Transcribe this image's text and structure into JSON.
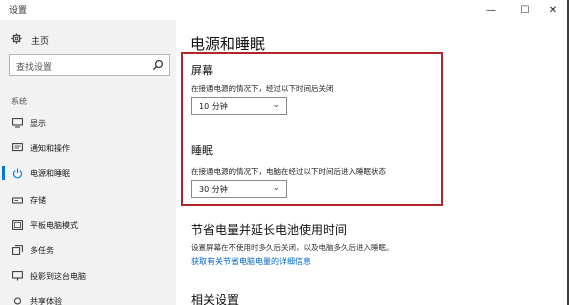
{
  "window": {
    "title": "设置",
    "minimize_glyph": "—",
    "maximize_glyph": "☐",
    "close_glyph": "✕"
  },
  "sidebar": {
    "home_label": "主页",
    "search_placeholder": "查找设置",
    "section_label": "系统",
    "items": [
      {
        "label": "显示",
        "icon": "monitor-icon"
      },
      {
        "label": "通知和操作",
        "icon": "notification-icon"
      },
      {
        "label": "电源和睡眠",
        "icon": "power-icon",
        "active": true
      },
      {
        "label": "存储",
        "icon": "storage-icon"
      },
      {
        "label": "平板电脑模式",
        "icon": "tablet-icon"
      },
      {
        "label": "多任务",
        "icon": "multitask-icon"
      },
      {
        "label": "投影到这台电脑",
        "icon": "projector-icon"
      },
      {
        "label": "共享体验",
        "icon": "share-icon"
      }
    ]
  },
  "main": {
    "page_title": "电源和睡眠",
    "screen": {
      "heading": "屏幕",
      "description": "在接通电源的情况下，经过以下时间后关闭",
      "selected": "10 分钟"
    },
    "sleep": {
      "heading": "睡眠",
      "description": "在接通电源的情况下，电脑在经过以下时间后进入睡眠状态",
      "selected": "30 分钟"
    },
    "battery": {
      "heading": "节省电量并延长电池使用时间",
      "description": "设置屏幕在不使用时多久后关闭，以及电脑多久后进入睡眠。",
      "link": "获取有关节省电脑电量的详细信息"
    },
    "related": {
      "heading": "相关设置"
    }
  },
  "colors": {
    "accent": "#0078d7",
    "highlight_border": "#b0242b",
    "sidebar_bg": "#f2f2f2",
    "link": "#0066cc"
  }
}
